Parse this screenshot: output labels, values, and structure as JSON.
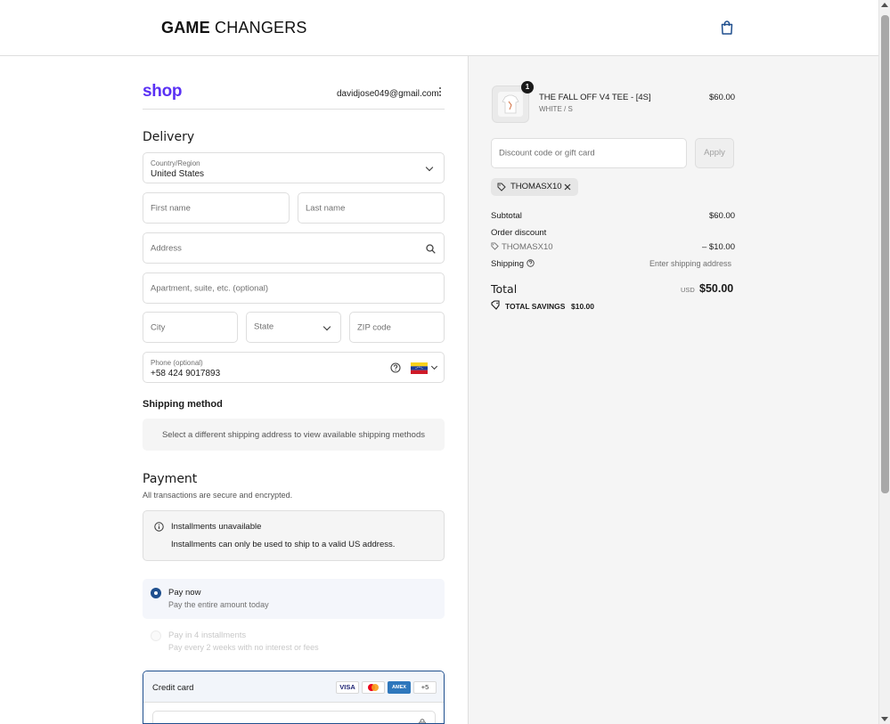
{
  "header": {
    "brand_bold": "GAME",
    "brand_rest": "CHANGERS",
    "cart_icon": "shopping-bag-icon"
  },
  "account": {
    "logo": "shop",
    "email": "davidjose049@gmail.com"
  },
  "delivery": {
    "title": "Delivery",
    "country_label": "Country/Region",
    "country_value": "United States",
    "first_name_placeholder": "First name",
    "last_name_placeholder": "Last name",
    "address_placeholder": "Address",
    "apartment_placeholder": "Apartment, suite, etc. (optional)",
    "city_placeholder": "City",
    "state_placeholder": "State",
    "zip_placeholder": "ZIP code",
    "phone_label": "Phone (optional)",
    "phone_value": "+58 424 9017893"
  },
  "shipping_method": {
    "title": "Shipping method",
    "message": "Select a different shipping address to view available shipping methods"
  },
  "payment": {
    "title": "Payment",
    "subtitle": "All transactions are secure and encrypted.",
    "notice_title": "Installments unavailable",
    "notice_body": "Installments can only be used to ship to a valid US address.",
    "pay_now_label": "Pay now",
    "pay_now_desc": "Pay the entire amount today",
    "installments_label": "Pay in 4 installments",
    "installments_desc": "Pay every 2 weeks with no interest or fees",
    "credit_card_label": "Credit card",
    "card_brands": [
      "VISA",
      "AMEX",
      "+5"
    ],
    "accent_color": "#1f4f8e"
  },
  "summary": {
    "item_name": "THE FALL OFF V4 TEE - [4S]",
    "item_variant": "WHITE / S",
    "item_price": "$60.00",
    "item_qty": "1",
    "discount_placeholder": "Discount code or gift card",
    "apply_label": "Apply",
    "applied_code": "THOMASX10",
    "subtotal_label": "Subtotal",
    "subtotal_value": "$60.00",
    "order_discount_label": "Order discount",
    "discount_code": "THOMASX10",
    "discount_value": "– $10.00",
    "shipping_label": "Shipping",
    "shipping_value": "Enter shipping address",
    "total_label": "Total",
    "total_currency": "USD",
    "total_value": "$50.00",
    "savings_label": "TOTAL SAVINGS",
    "savings_value": "$10.00"
  }
}
